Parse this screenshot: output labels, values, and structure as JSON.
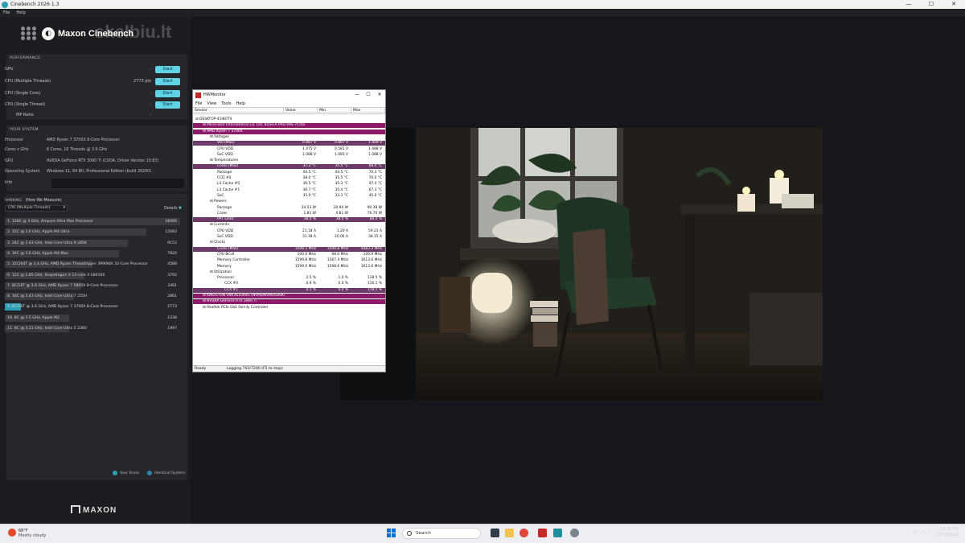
{
  "window": {
    "title": "Cinebench 2026 1.3",
    "controls": [
      "—",
      "☐",
      "✕"
    ]
  },
  "menu": [
    "File",
    "Help"
  ],
  "logo": {
    "text": "Maxon Cinebench",
    "watermark": "skelbiu.lt"
  },
  "performance": {
    "heading": "PERFORMANCE",
    "rows": [
      {
        "label": "GPU",
        "value": "-",
        "button": "Start"
      },
      {
        "label": "CPU (Multiple Threads)",
        "value": "2773 pts",
        "button": "Start"
      },
      {
        "label": "CPU (Single Core)",
        "value": "-",
        "button": "Start"
      },
      {
        "label": "CPU (Single Thread)",
        "value": "-",
        "button": "Start"
      },
      {
        "label": "MP Ratio",
        "value": "-",
        "button": ""
      }
    ]
  },
  "system": {
    "heading": "YOUR SYSTEM",
    "rows": [
      {
        "k": "Processor",
        "v": "AMD Ryzen 7 3700X 8-Core Processor"
      },
      {
        "k": "Cores x GHz",
        "v": "8 Cores, 16 Threads @ 3.6 GHz"
      },
      {
        "k": "GPU",
        "v": "NVIDIA GeForce RTX 3060 Ti (CUDA, Driver Version 10.83)"
      },
      {
        "k": "Operating System",
        "v": "Windows 11, 64 Bit, Professional Edition (build 26200)"
      },
      {
        "k": "Info",
        "v": ""
      }
    ]
  },
  "ranking": {
    "heading": "RANKING",
    "heading_link": "(How We Measure)",
    "dropdown": "CPU (Multiple Threads)",
    "details": "Details",
    "rows": [
      {
        "label": "1. 128C @ 3 GHz, Ampere Altra Max Processor",
        "score": 18495,
        "me": false
      },
      {
        "label": "2. 32C @ 3.6 GHz, Apple M4 Ultra",
        "score": 12082,
        "me": false
      },
      {
        "label": "3. 24C @ 3.43 GHz, Intel Core Ultra 9 285K",
        "score": 9152,
        "me": false
      },
      {
        "label": "4. 16C @ 3.6 GHz, Apple M4 Max",
        "score": 7820,
        "me": false
      },
      {
        "label": "5. 32C/64T @ 3.4 GHz, AMD Ryzen Threadripper 3990WX 32-Core Processor",
        "score": 4588,
        "me": false
      },
      {
        "label": "6. 12C @ 2.85 GHz, Snapdragon X 12-core X E80100",
        "score": 3792,
        "me": false
      },
      {
        "label": "7. 8C/16T @ 3.0 GHz, AMD Ryzen 7 5800X 8-Core Processor",
        "score": 3481,
        "me": false
      },
      {
        "label": "8. 16C @ 3.43 GHz, Intel Core Ultra 7 255H",
        "score": 2861,
        "me": false
      },
      {
        "label": "9. 8C/16T @ 3.6 GHz, AMD Ryzen 7 3700X 8-Core Processor",
        "score": 2773,
        "me": true
      },
      {
        "label": "10. 8C @ 3.5 GHz, Apple M2",
        "score": 2338,
        "me": false
      },
      {
        "label": "11. 8C @ 3.21 GHz, Intel Core Ultra 5 238V",
        "score": 1997,
        "me": false
      }
    ]
  },
  "legend": {
    "a": "Your Score",
    "b": "Identical System"
  },
  "footer_brand": "MAXON",
  "hwmonitor": {
    "title": "HWMonitor",
    "menu": [
      "File",
      "View",
      "Tools",
      "Help"
    ],
    "columns": [
      "Sensor",
      "Value",
      "Min",
      "Max"
    ],
    "rows": [
      {
        "indent": 0,
        "name": "DESKTOP-41I8OT4",
        "v": "",
        "mn": "",
        "mx": "",
        "style": ""
      },
      {
        "indent": 1,
        "name": "Micro-Star International Co. Ltd. B550-A PRO (MS-7C56)",
        "v": "",
        "mn": "",
        "mx": "",
        "style": "p"
      },
      {
        "indent": 1,
        "name": "AMD Ryzen 7 3700X",
        "v": "",
        "mn": "",
        "mx": "",
        "style": "p"
      },
      {
        "indent": 2,
        "name": "Voltages",
        "v": "",
        "mn": "",
        "mx": "",
        "style": ""
      },
      {
        "indent": 3,
        "name": "VID (Max)",
        "v": "0.887 V",
        "mn": "0.887 V",
        "mx": "1.469 V",
        "style": "sel"
      },
      {
        "indent": 3,
        "name": "CPU VDD",
        "v": "1.475 V",
        "mn": "0.581 V",
        "mx": "1.488 V",
        "style": ""
      },
      {
        "indent": 3,
        "name": "SoC VDD",
        "v": "1.088 V",
        "mn": "1.081 V",
        "mx": "1.088 V",
        "style": ""
      },
      {
        "indent": 2,
        "name": "Temperatures",
        "v": "",
        "mn": "",
        "mx": "",
        "style": ""
      },
      {
        "indent": 3,
        "name": "Cores (Max)",
        "v": "37.3 °C",
        "mn": "35.4 °C",
        "mx": "68.0 °C",
        "style": "sel"
      },
      {
        "indent": 3,
        "name": "Package",
        "v": "44.5 °C",
        "mn": "44.5 °C",
        "mx": "70.3 °C",
        "style": ""
      },
      {
        "indent": 3,
        "name": "CCD #0",
        "v": "38.0 °C",
        "mn": "35.5 °C",
        "mx": "70.0 °C",
        "style": ""
      },
      {
        "indent": 3,
        "name": "L3 Cache #0",
        "v": "36.5 °C",
        "mn": "35.3 °C",
        "mx": "47.4 °C",
        "style": ""
      },
      {
        "indent": 3,
        "name": "L3 Cache #1",
        "v": "36.7 °C",
        "mn": "35.4 °C",
        "mx": "67.3 °C",
        "style": ""
      },
      {
        "indent": 3,
        "name": "SoC",
        "v": "35.0 °C",
        "mn": "33.3 °C",
        "mx": "45.0 °C",
        "style": ""
      },
      {
        "indent": 2,
        "name": "Powers",
        "v": "",
        "mn": "",
        "mx": "",
        "style": ""
      },
      {
        "indent": 3,
        "name": "Package",
        "v": "34.53 W",
        "mn": "20.94 W",
        "mx": "90.38 W",
        "style": ""
      },
      {
        "indent": 3,
        "name": "Cores",
        "v": "1.81 W",
        "mn": "0.81 W",
        "mx": "76.70 W",
        "style": ""
      },
      {
        "indent": 3,
        "name": "PPT Limit",
        "v": "38.0 %",
        "mn": "38.0 %",
        "mx": "88.0 %",
        "style": "sel"
      },
      {
        "indent": 2,
        "name": "Currents",
        "v": "",
        "mn": "",
        "mx": "",
        "style": ""
      },
      {
        "indent": 3,
        "name": "CPU VDD",
        "v": "21.18 A",
        "mn": "1.20 A",
        "mx": "59.23 A",
        "style": ""
      },
      {
        "indent": 3,
        "name": "SoC VDD",
        "v": "31.18 A",
        "mn": "20.06 A",
        "mx": "38.15 A",
        "style": ""
      },
      {
        "indent": 2,
        "name": "Clocks",
        "v": "",
        "mn": "",
        "mx": "",
        "style": ""
      },
      {
        "indent": 3,
        "name": "Cores (Max)",
        "v": "3596.5 MHz",
        "mn": "3596.8 MHz",
        "mx": "4483.3 MHz",
        "style": "sel"
      },
      {
        "indent": 3,
        "name": "CPU BCLK",
        "v": "100.0 MHz",
        "mn": "98.0 MHz",
        "mx": "100.9 MHz",
        "style": ""
      },
      {
        "indent": 3,
        "name": "Memory Controller",
        "v": "1599.8 MHz",
        "mn": "1567.4 MHz",
        "mx": "1613.6 MHz",
        "style": ""
      },
      {
        "indent": 3,
        "name": "Memory",
        "v": "1599.0 MHz",
        "mn": "1598.6 MHz",
        "mx": "1613.6 MHz",
        "style": ""
      },
      {
        "indent": 2,
        "name": "Utilization",
        "v": "",
        "mn": "",
        "mx": "",
        "style": ""
      },
      {
        "indent": 3,
        "name": "Processor",
        "v": "2.5 %",
        "mn": "1.0 %",
        "mx": "118.5 %",
        "style": ""
      },
      {
        "indent": 4,
        "name": "CCX #0",
        "v": "0.9 %",
        "mn": "0.0 %",
        "mx": "116.1 %",
        "style": ""
      },
      {
        "indent": 4,
        "name": "CCX #1",
        "v": "4.1 %",
        "mn": "0.0 %",
        "mx": "118.5 %",
        "style": "sel"
      },
      {
        "indent": 1,
        "name": "KINGSTON SNV3S1000G (NVMe/NVMe/DISK)",
        "v": "",
        "mn": "",
        "mx": "",
        "style": "p"
      },
      {
        "indent": 1,
        "name": "NVIDIA GeForce RTX 3060 Ti",
        "v": "",
        "mn": "",
        "mx": "",
        "style": "p"
      },
      {
        "indent": 1,
        "name": "Realtek PCIe GbE Family Controller",
        "v": "",
        "mn": "",
        "mx": "",
        "style": ""
      }
    ],
    "status": [
      "Ready",
      "Logging 703/7200 (F5 to stop)"
    ]
  },
  "taskbar": {
    "weather_temp": "68°F",
    "weather_desc": "Mostly cloudy",
    "search_placeholder": "Search",
    "clock_time": "12:00 PM",
    "clock_date": "8/19/2026"
  }
}
